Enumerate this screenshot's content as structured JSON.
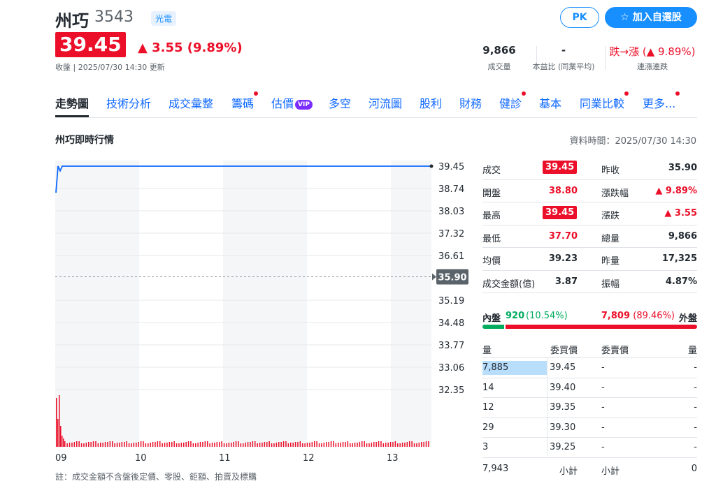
{
  "stock": {
    "name": "州巧",
    "code": "3543",
    "industry": "光電",
    "price": "39.45",
    "change": "▲ 3.55 (9.89%)",
    "close_info": "收盤 | 2025/07/30 14:30 更新"
  },
  "actions": {
    "pk_label": "PK",
    "watchlist_label": "☆ 加入自選股"
  },
  "metrics": [
    {
      "value": "9,866",
      "label": "成交量"
    },
    {
      "value": "-",
      "label": "本益比 (同業平均)"
    },
    {
      "value": "跌→漲 (▲ 9.89%)",
      "label": "連漲連跌"
    }
  ],
  "tabs": [
    {
      "label": "走勢圖",
      "active": true,
      "dot": false
    },
    {
      "label": "技術分析",
      "dot": false
    },
    {
      "label": "成交彙整",
      "dot": false
    },
    {
      "label": "籌碼",
      "dot": true
    },
    {
      "label": "估價",
      "dot": false,
      "vip": "VIP"
    },
    {
      "label": "多空",
      "dot": false
    },
    {
      "label": "河流圖",
      "dot": false
    },
    {
      "label": "股利",
      "dot": false
    },
    {
      "label": "財務",
      "dot": false
    },
    {
      "label": "健診",
      "dot": true
    },
    {
      "label": "基本",
      "dot": false
    },
    {
      "label": "同業比較",
      "dot": true
    },
    {
      "label": "更多...",
      "dot": true
    }
  ],
  "section": {
    "title": "州巧即時行情",
    "data_time": "資料時間：2025/07/30 14:30"
  },
  "chart_data": {
    "type": "line",
    "x_ticks": [
      "09",
      "10",
      "11",
      "12",
      "13"
    ],
    "y_ticks": [
      "39.45",
      "38.74",
      "38.03",
      "37.32",
      "36.61",
      "35.19",
      "34.48",
      "33.77",
      "33.06",
      "32.35"
    ],
    "ylim": [
      32.35,
      39.45
    ],
    "reference": "35.90",
    "series": [
      {
        "values": [
          38.6,
          39.45,
          39.3,
          39.45,
          39.45,
          39.45,
          39.45
        ]
      }
    ],
    "volume_note": "volume bars: large spike at open, then small bars"
  },
  "quote": {
    "left": [
      {
        "label": "成交",
        "value": "39.45",
        "badge": true
      },
      {
        "label": "開盤",
        "value": "38.80",
        "color": "up"
      },
      {
        "label": "最高",
        "value": "39.45",
        "badge": true
      },
      {
        "label": "最低",
        "value": "37.70",
        "color": "up"
      },
      {
        "label": "均價",
        "value": "39.23"
      },
      {
        "label": "成交金額(億)",
        "value": "3.87"
      }
    ],
    "right": [
      {
        "label": "昨收",
        "value": "35.90"
      },
      {
        "label": "漲跌幅",
        "value": "▲ 9.89%",
        "color": "up"
      },
      {
        "label": "漲跌",
        "value": "▲ 3.55",
        "color": "up"
      },
      {
        "label": "總量",
        "value": "9,866"
      },
      {
        "label": "昨量",
        "value": "17,325"
      },
      {
        "label": "振幅",
        "value": "4.87%"
      }
    ]
  },
  "bidask": {
    "inner_label": "內盤",
    "inner_value": "920",
    "inner_pct": "(10.54%)",
    "outer_value": "7,809",
    "outer_pct": "(89.46%)",
    "outer_label": "外盤",
    "inner_ratio": 0.1054
  },
  "orderbook": {
    "headers": [
      "量",
      "委買價",
      "委賣價",
      "量"
    ],
    "rows": [
      {
        "bid_qty": "7,885",
        "bid_price": "39.45",
        "ask_price": "-",
        "ask_qty": "-",
        "bar": 1.0
      },
      {
        "bid_qty": "14",
        "bid_price": "39.40",
        "ask_price": "-",
        "ask_qty": "-",
        "bar": 0
      },
      {
        "bid_qty": "12",
        "bid_price": "39.35",
        "ask_price": "-",
        "ask_qty": "-",
        "bar": 0
      },
      {
        "bid_qty": "29",
        "bid_price": "39.30",
        "ask_price": "-",
        "ask_qty": "-",
        "bar": 0
      },
      {
        "bid_qty": "3",
        "bid_price": "39.25",
        "ask_price": "-",
        "ask_qty": "-",
        "bar": 0
      }
    ],
    "total_bid": "7,943",
    "subtotal_label": "小計",
    "total_ask": "0"
  },
  "footnote": "註：成交金額不含盤後定價、零股、鉅額、拍賣及標購"
}
